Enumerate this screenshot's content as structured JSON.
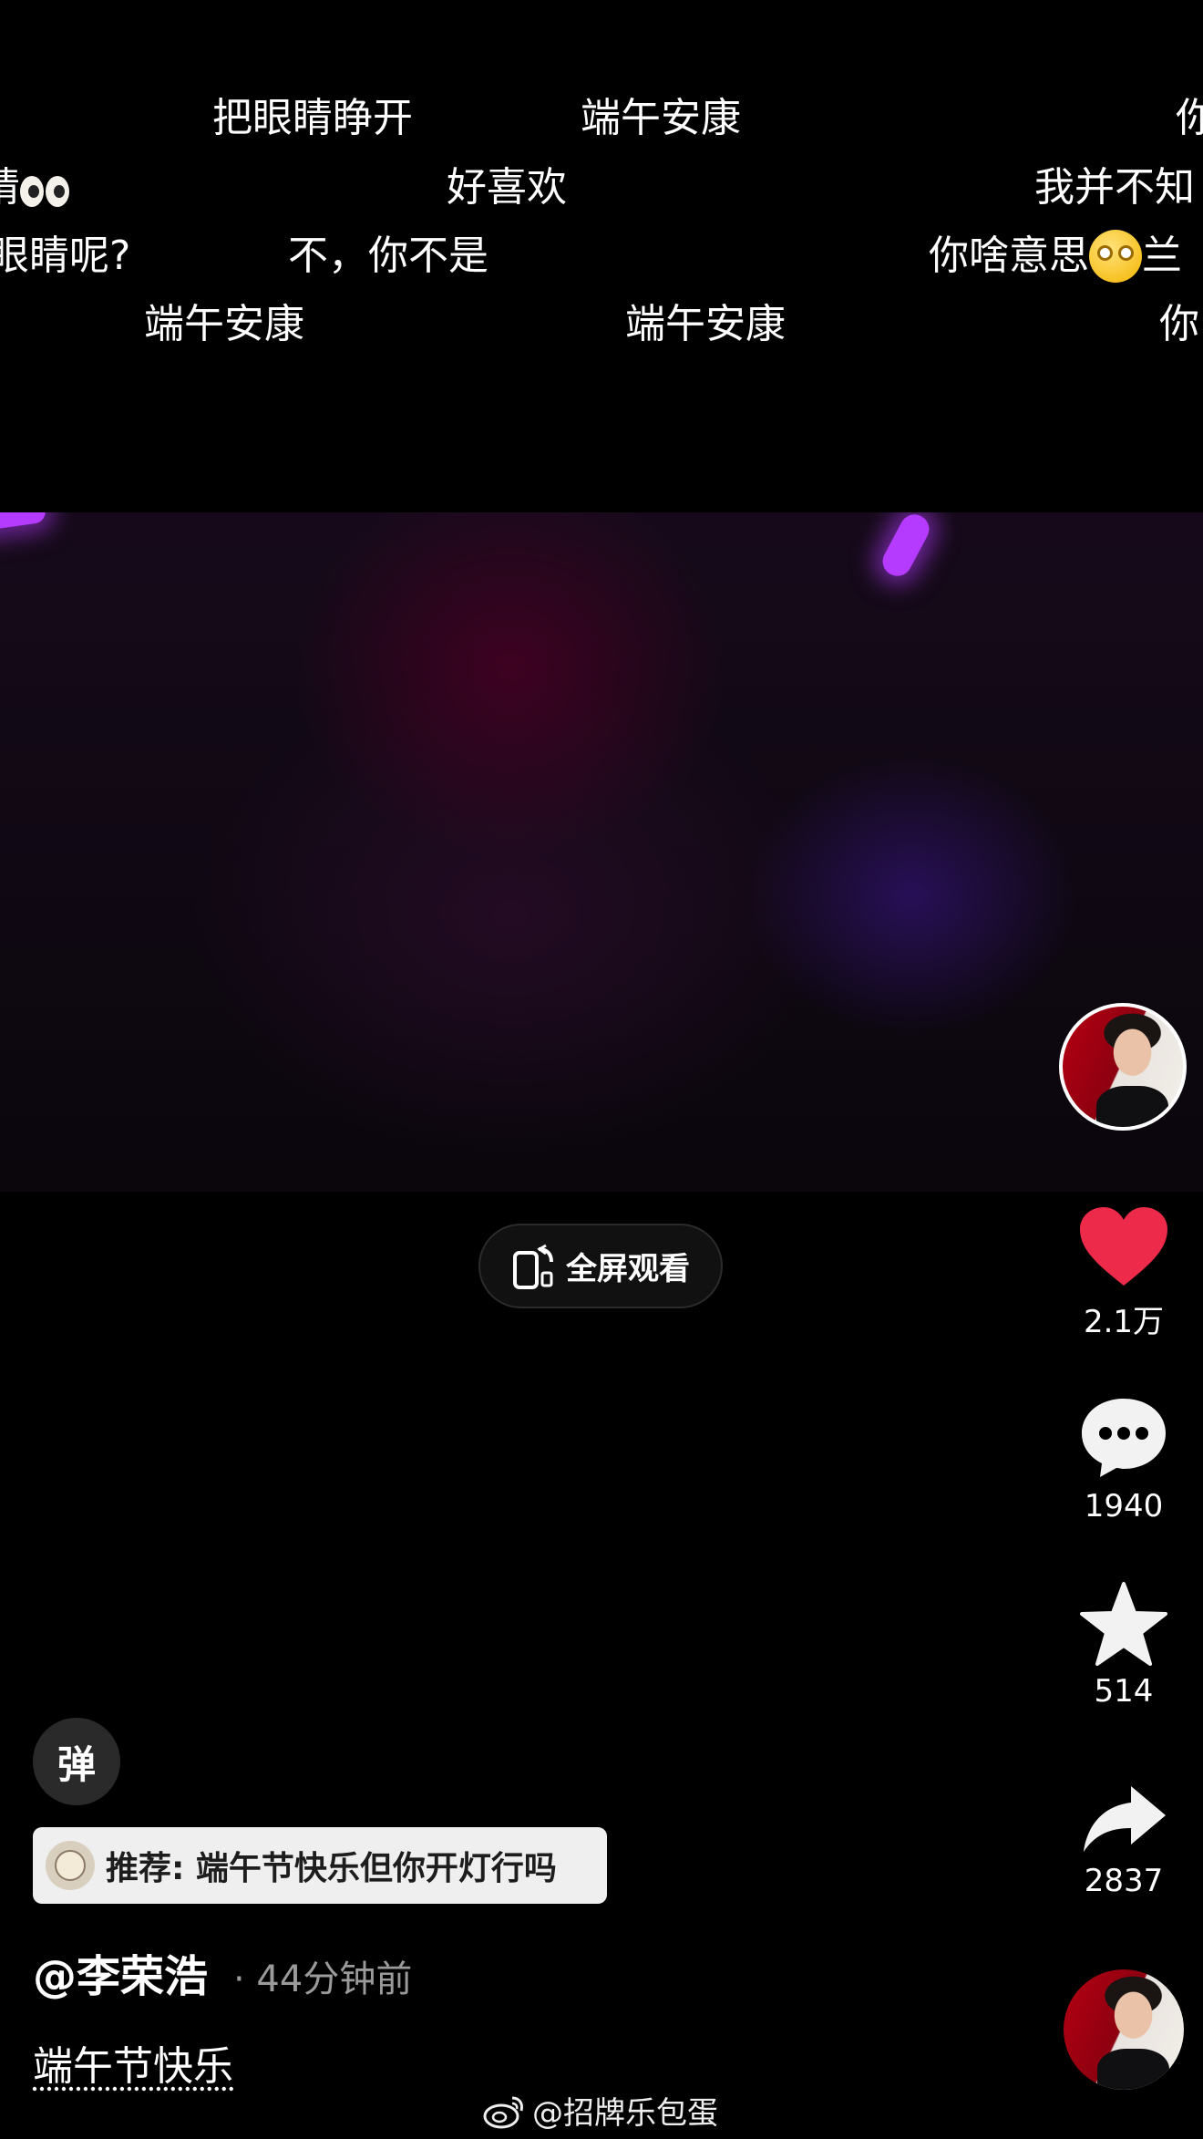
{
  "danmaku": {
    "r1": [
      "把眼睛睁开",
      "端午安康",
      "你"
    ],
    "r2": [
      "睛",
      "好喜欢",
      "我并不知"
    ],
    "r3": [
      "眼睛呢?",
      "不，你不是",
      "你啥意思",
      "兰"
    ],
    "r4": [
      "端午安康",
      "端午安康",
      "你"
    ]
  },
  "fullscreen": {
    "label": "全屏观看"
  },
  "actions": {
    "like": {
      "count": "2.1万",
      "color": "#ee2a4a"
    },
    "comment": {
      "count": "1940"
    },
    "favorite": {
      "count": "514"
    },
    "share": {
      "count": "2837"
    }
  },
  "danmaku_toggle": {
    "label": "弹"
  },
  "recommend": {
    "text": "推荐: 端午节快乐但你开灯行吗"
  },
  "post": {
    "author": "@李荣浩",
    "time": "· 44分钟前",
    "caption": "端午节快乐"
  },
  "watermark": {
    "text": "@招牌乐包蛋"
  }
}
